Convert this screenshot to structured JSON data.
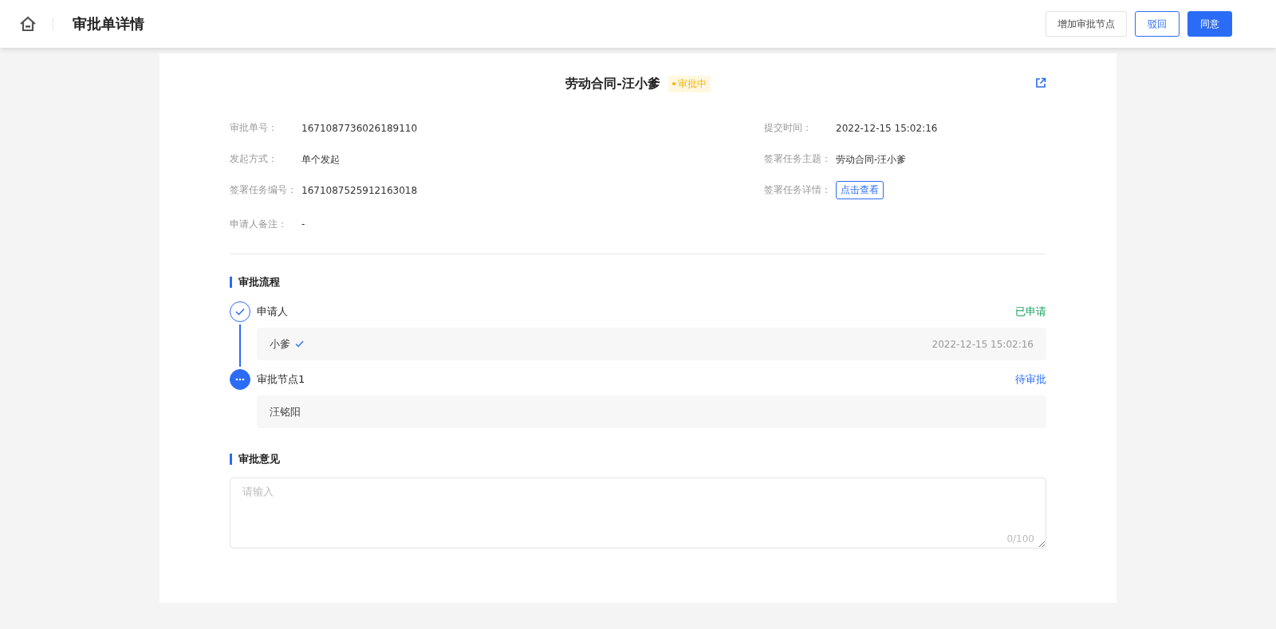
{
  "header": {
    "title": "审批单详情",
    "buttons": [
      {
        "label": "增加审批节点",
        "kind": "default"
      },
      {
        "label": "驳回",
        "kind": "outline"
      },
      {
        "label": "同意",
        "kind": "primary"
      }
    ]
  },
  "document": {
    "title": "劳动合同-汪小爹",
    "status": "审批中"
  },
  "fields": {
    "left": [
      {
        "label": "审批单号：",
        "value": "1671087736026189110",
        "kind": "text"
      },
      {
        "label": "发起方式：",
        "value": "单个发起",
        "kind": "text"
      },
      {
        "label": "签署任务编号：",
        "value": "1671087525912163018",
        "kind": "text"
      },
      {
        "label": "申请人备注：",
        "value": "-",
        "kind": "text"
      }
    ],
    "right": [
      {
        "label": "提交时间：",
        "value": "2022-12-15 15:02:16",
        "kind": "text"
      },
      {
        "label": "签署任务主题：",
        "value": "劳动合同-汪小爹",
        "kind": "text"
      },
      {
        "label": "签署任务详情：",
        "value": "点击查看",
        "kind": "link"
      }
    ]
  },
  "flow": {
    "title": "审批流程",
    "steps": [
      {
        "name": "申请人",
        "status": "已申请",
        "kind": "done",
        "person": "小爹",
        "verified": true,
        "time": "2022-12-15 15:02:16"
      },
      {
        "name": "审批节点1",
        "status": "待审批",
        "kind": "pending",
        "person": "汪铭阳",
        "verified": false
      }
    ]
  },
  "opinion": {
    "title": "审批意见",
    "placeholder": "请输入",
    "counter": "0/100"
  }
}
